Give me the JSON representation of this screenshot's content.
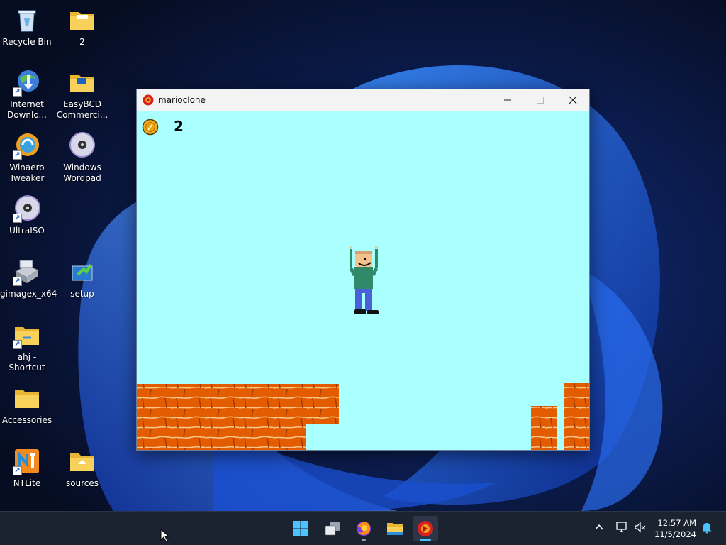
{
  "desktop": {
    "icons": [
      {
        "label": "Recycle Bin",
        "icon": "recycle-bin-icon"
      },
      {
        "label": "2",
        "icon": "folder-icon"
      },
      {
        "label": "Internet Downlo...",
        "icon": "internet-download-manager-icon"
      },
      {
        "label": "EasyBCD Commerci...",
        "icon": "folder-icon"
      },
      {
        "label": "Winaero Tweaker",
        "icon": "winaero-tweaker-icon"
      },
      {
        "label": "Windows Wordpad",
        "icon": "disc-icon"
      },
      {
        "label": "UltraISO",
        "icon": "disc-icon"
      },
      {
        "label": "gimagex_x64",
        "icon": "drive-icon"
      },
      {
        "label": "setup",
        "icon": "setup-icon"
      },
      {
        "label": "ahj - Shortcut",
        "icon": "folder-icon"
      },
      {
        "label": "Accessories",
        "icon": "folder-icon"
      },
      {
        "label": "NTLite",
        "icon": "ntlite-icon"
      },
      {
        "label": "sources",
        "icon": "folder-icon"
      }
    ]
  },
  "window": {
    "title": "marioclone",
    "icon": "marioclone-app-icon"
  },
  "game": {
    "coins": "2",
    "background_color": "#aaffff",
    "brick_color": "#e35d00"
  },
  "taskbar": {
    "items": [
      "start-icon",
      "task-view-icon",
      "firefox-icon",
      "file-explorer-icon",
      "marioclone-taskbar-icon"
    ],
    "clock_time": "12:57 AM",
    "clock_date": "11/5/2024"
  },
  "colors": {
    "accent": "#4cc2ff",
    "taskbar": "#1b2230"
  }
}
